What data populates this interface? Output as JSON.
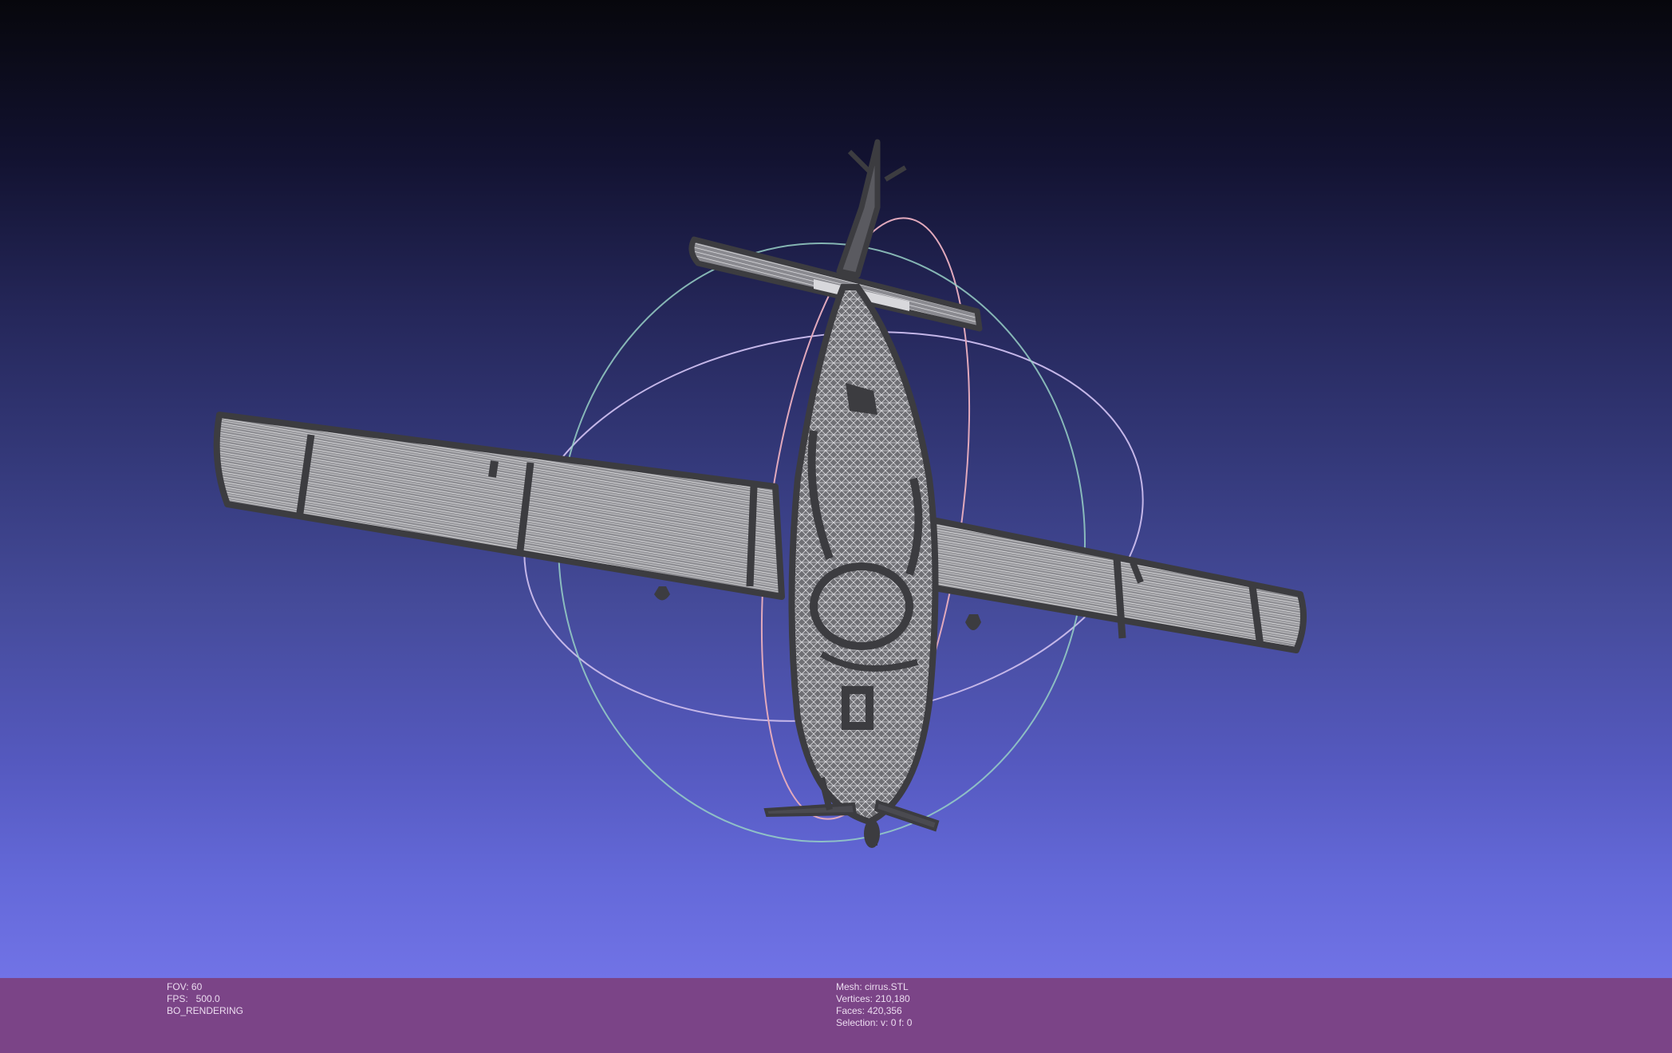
{
  "viewer": {
    "background_top_color": "#07070c",
    "background_bottom_color": "#7173e6",
    "model_icon": "airplane-wireframe",
    "trackball_icon": "trackball-rings"
  },
  "status_bar": {
    "background_color": "#7b4487",
    "left": {
      "fov": "FOV: 60",
      "fps": "FPS:   500.0",
      "render_mode": "BO_RENDERING"
    },
    "right": {
      "mesh": "Mesh: cirrus.STL",
      "vertices": "Vertices: 210,180",
      "faces": "Faces: 420,356",
      "selection": "Selection: v: 0 f: 0"
    }
  }
}
